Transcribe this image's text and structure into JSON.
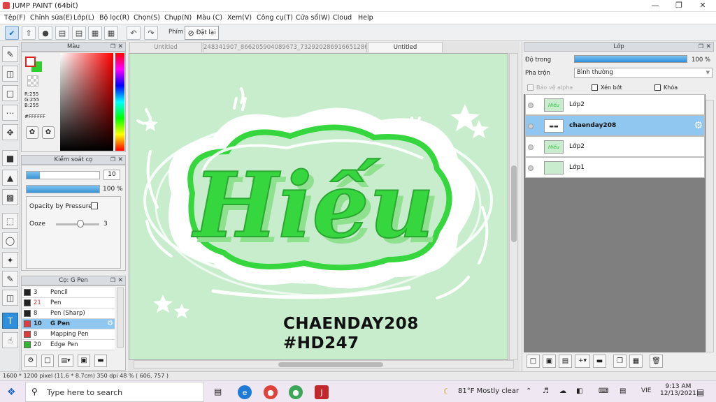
{
  "window": {
    "title": "JUMP PAINT (64bit)"
  },
  "menu": [
    "Tệp(F)",
    "Chỉnh sửa(E)",
    "Lớp(L)",
    "Bộ lọc(R)",
    "Chọn(S)",
    "Chụp(N)",
    "Màu (C)",
    "Xem(V)",
    "Công cụ(T)",
    "Cửa sổ(W)",
    "Cloud",
    "Help"
  ],
  "toolbar": {
    "brand_label": "Phím",
    "reset_label": "Đặt lại"
  },
  "color_panel": {
    "title": "Màu",
    "r": "R:255",
    "g": "G:255",
    "b": "B:255",
    "hex": "#FFFFFF"
  },
  "brush_control": {
    "title": "Kiểm soát cọ",
    "size_value": "10",
    "opacity_value": "100 %",
    "pressure_label": "Opacity by Pressure",
    "ooze_label": "Ooze",
    "ooze_value": "3"
  },
  "brush_list": {
    "title": "Cọ: G Pen",
    "items": [
      {
        "size": "3",
        "name": "Pencil",
        "swatch": "#222222",
        "size_color": "#222222"
      },
      {
        "size": "21",
        "name": "Pen",
        "swatch": "#222222",
        "size_color": "#d23a3a"
      },
      {
        "size": "8",
        "name": "Pen (Sharp)",
        "swatch": "#222222",
        "size_color": "#222222"
      },
      {
        "size": "10",
        "name": "G Pen",
        "swatch": "#e23b3b",
        "size_color": "#222222"
      },
      {
        "size": "8",
        "name": "Mapping Pen",
        "swatch": "#e23b3b",
        "size_color": "#222222"
      },
      {
        "size": "20",
        "name": "Edge Pen",
        "swatch": "#2fb52f",
        "size_color": "#222222"
      }
    ]
  },
  "doc_tabs": [
    "Untitled",
    "248341907_866205904089673_7329202869166512864_n.jpg",
    "Untitled"
  ],
  "canvas": {
    "word": "Hiếu",
    "line1": "CHAENDAY208",
    "line2": "#HD247"
  },
  "layer_panel": {
    "title": "Lớp",
    "opacity_label": "Độ trong",
    "opacity_value": "100 %",
    "blend_label": "Pha trộn",
    "blend_value": "Bình thường",
    "protect_alpha": "Bảo vệ alpha",
    "clip": "Xén bớt",
    "lock": "Khóa",
    "layers": [
      {
        "name": "Lớp2",
        "thumb": "Hiếu"
      },
      {
        "name": "chaenday208",
        "thumb": "▬▬"
      },
      {
        "name": "Lớp2",
        "thumb": "Hiếu"
      },
      {
        "name": "Lớp1",
        "thumb": ""
      }
    ]
  },
  "status": {
    "text": "1600 * 1200 pixel   (11.6 * 8.7cm)   350 dpi   48 %   ( 606, 757 )"
  },
  "taskbar": {
    "search_placeholder": "Type here to search",
    "weather": "81°F  Mostly clear",
    "lang": "VIE",
    "time": "9:13 AM",
    "date": "12/13/2021"
  },
  "colors": {
    "accent_blue": "#2f8fdb",
    "canvas_bg": "#c7edcc",
    "lettering_green": "#36d63e",
    "layer_selected": "#8fc7f0"
  }
}
